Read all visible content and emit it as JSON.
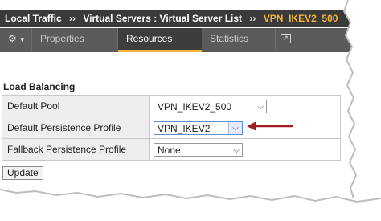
{
  "breadcrumb": {
    "items": [
      "Local Traffic",
      "Virtual Servers : Virtual Server List"
    ],
    "separator": "››",
    "current": "VPN_IKEV2_500"
  },
  "tabs": {
    "gear_icon": "gear-icon",
    "properties": "Properties",
    "resources": "Resources",
    "statistics": "Statistics",
    "popout_icon": "popout-icon"
  },
  "section": {
    "title": "Load Balancing"
  },
  "fields": {
    "default_pool": {
      "label": "Default Pool",
      "value": "VPN_IKEV2_500"
    },
    "default_persistence_profile": {
      "label": "Default Persistence Profile",
      "value": "VPN_IKEV2"
    },
    "fallback_persistence_profile": {
      "label": "Fallback Persistence Profile",
      "value": "None"
    }
  },
  "buttons": {
    "update": "Update"
  },
  "colors": {
    "breadcrumb_bg": "#3a3a3a",
    "tabbar_bg": "#5b5b5b",
    "active_tab_accent": "#f3b53b",
    "current_crumb": "#f3b53b",
    "arrow": "#a01f24"
  }
}
